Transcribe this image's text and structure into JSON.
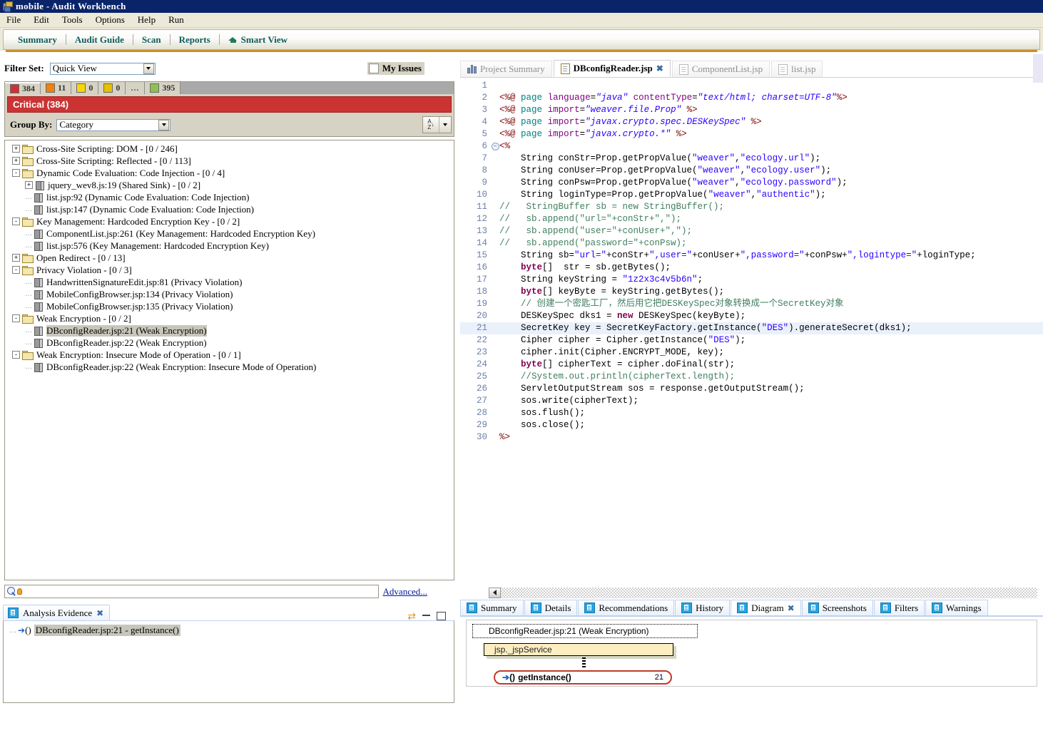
{
  "window": {
    "title": "mobile - Audit Workbench",
    "icon": "app-icon"
  },
  "menu": {
    "items": [
      "File",
      "Edit",
      "Tools",
      "Options",
      "Help",
      "Run"
    ]
  },
  "toolbar": {
    "items": [
      "Summary",
      "Audit Guide",
      "Scan",
      "Reports"
    ],
    "smart_view": "Smart View",
    "smart_view_icon": "graduation-cap-icon"
  },
  "filter": {
    "label": "Filter Set:",
    "value": "Quick View",
    "my_issues_label": "My Issues",
    "my_issues_checked": false,
    "group_by_label": "Group By:",
    "group_by_value": "Category",
    "sort_button_label": "A Z",
    "severity_tabs": [
      {
        "count": "384",
        "color": "#cc3333",
        "active": true
      },
      {
        "count": "11",
        "color": "#f08010",
        "active": false
      },
      {
        "count": "0",
        "color": "#f7d70a",
        "active": false
      },
      {
        "count": "0",
        "color": "#e5c200",
        "active": false
      },
      {
        "count": "...",
        "color": "",
        "active": false
      },
      {
        "count": "395",
        "color": "#8cc152",
        "active": false
      }
    ],
    "critical_banner": "Critical (384)"
  },
  "tree": {
    "nodes": [
      {
        "depth": 0,
        "toggle": "+",
        "icon": "folder-icon",
        "label": "Cross-Site Scripting: DOM - [0 / 246]",
        "selected": false
      },
      {
        "depth": 0,
        "toggle": "+",
        "icon": "folder-icon",
        "label": "Cross-Site Scripting: Reflected - [0 / 113]",
        "selected": false
      },
      {
        "depth": 0,
        "toggle": "-",
        "icon": "folder-icon",
        "label": "Dynamic Code Evaluation: Code Injection - [0 / 4]",
        "selected": false
      },
      {
        "depth": 1,
        "toggle": "+",
        "icon": "document-icon",
        "label": "jquery_wev8.js:19 (Shared Sink) - [0 / 2]",
        "selected": false
      },
      {
        "depth": 1,
        "toggle": "",
        "icon": "document-icon",
        "label": "list.jsp:92 (Dynamic Code Evaluation: Code Injection)",
        "selected": false
      },
      {
        "depth": 1,
        "toggle": "",
        "icon": "document-icon",
        "label": "list.jsp:147 (Dynamic Code Evaluation: Code Injection)",
        "selected": false
      },
      {
        "depth": 0,
        "toggle": "-",
        "icon": "folder-icon",
        "label": "Key Management: Hardcoded Encryption Key - [0 / 2]",
        "selected": false
      },
      {
        "depth": 1,
        "toggle": "",
        "icon": "document-icon",
        "label": "ComponentList.jsp:261 (Key Management: Hardcoded Encryption Key)",
        "selected": false
      },
      {
        "depth": 1,
        "toggle": "",
        "icon": "document-icon",
        "label": "list.jsp:576 (Key Management: Hardcoded Encryption Key)",
        "selected": false
      },
      {
        "depth": 0,
        "toggle": "+",
        "icon": "folder-icon",
        "label": "Open Redirect - [0 / 13]",
        "selected": false
      },
      {
        "depth": 0,
        "toggle": "-",
        "icon": "folder-icon",
        "label": "Privacy Violation - [0 / 3]",
        "selected": false
      },
      {
        "depth": 1,
        "toggle": "",
        "icon": "document-icon",
        "label": "HandwrittenSignatureEdit.jsp:81 (Privacy Violation)",
        "selected": false
      },
      {
        "depth": 1,
        "toggle": "",
        "icon": "document-icon",
        "label": "MobileConfigBrowser.jsp:134 (Privacy Violation)",
        "selected": false
      },
      {
        "depth": 1,
        "toggle": "",
        "icon": "document-icon",
        "label": "MobileConfigBrowser.jsp:135 (Privacy Violation)",
        "selected": false
      },
      {
        "depth": 0,
        "toggle": "-",
        "icon": "folder-icon",
        "label": "Weak Encryption - [0 / 2]",
        "selected": false
      },
      {
        "depth": 1,
        "toggle": "",
        "icon": "document-icon",
        "label": "DBconfigReader.jsp:21 (Weak Encryption)",
        "selected": true
      },
      {
        "depth": 1,
        "toggle": "",
        "icon": "document-icon",
        "label": "DBconfigReader.jsp:22 (Weak Encryption)",
        "selected": false
      },
      {
        "depth": 0,
        "toggle": "-",
        "icon": "folder-icon",
        "label": "Weak Encryption: Insecure Mode of Operation - [0 / 1]",
        "selected": false
      },
      {
        "depth": 1,
        "toggle": "",
        "icon": "document-icon",
        "label": "DBconfigReader.jsp:22 (Weak Encryption: Insecure Mode of Operation)",
        "selected": false
      }
    ]
  },
  "search": {
    "placeholder": "",
    "value": "",
    "advanced_label": "Advanced..."
  },
  "evidence": {
    "tab_label": "Analysis Evidence",
    "rows": [
      {
        "label": "DBconfigReader.jsp:21 - getInstance()",
        "selected": true
      }
    ]
  },
  "editor_tabs": [
    {
      "label": "Project Summary",
      "icon": "chart-icon",
      "active": false,
      "closable": false
    },
    {
      "label": "DBconfigReader.jsp",
      "icon": "page-icon",
      "active": true,
      "closable": true
    },
    {
      "label": "ComponentList.jsp",
      "icon": "page-icon",
      "active": false,
      "closable": false
    },
    {
      "label": "list.jsp",
      "icon": "page-icon",
      "active": false,
      "closable": false
    }
  ],
  "code": {
    "highlight_line": 21,
    "fold_line": 6,
    "lines": [
      {
        "n": 1,
        "html": ""
      },
      {
        "n": 2,
        "html": "<span class=\"jspbrk\">&lt;%@</span> <span class=\"jsp\">page</span> <span class=\"jspattr\">language</span>=<span class=\"str\"><i>\"java\"</i></span> <span class=\"jspattr\">contentType</span>=<span class=\"str\"><i>\"text/html; charset=UTF-8\"</i></span><span class=\"jspbrk\">%&gt;</span>"
      },
      {
        "n": 3,
        "html": "<span class=\"jspbrk\">&lt;%@</span> <span class=\"jsp\">page</span> <span class=\"jspattr\">import</span>=<span class=\"str\"><i>\"weaver.file.Prop\"</i></span> <span class=\"jspbrk\">%&gt;</span>"
      },
      {
        "n": 4,
        "html": "<span class=\"jspbrk\">&lt;%@</span> <span class=\"jsp\">page</span> <span class=\"jspattr\">import</span>=<span class=\"str\"><i>\"javax.crypto.spec.DESKeySpec\"</i></span> <span class=\"jspbrk\">%&gt;</span>"
      },
      {
        "n": 5,
        "html": "<span class=\"jspbrk\">&lt;%@</span> <span class=\"jsp\">page</span> <span class=\"jspattr\">import</span>=<span class=\"str\"><i>\"javax.crypto.*\"</i></span> <span class=\"jspbrk\">%&gt;</span>"
      },
      {
        "n": 6,
        "html": "<span class=\"jspbrk\">&lt;%</span>"
      },
      {
        "n": 7,
        "html": "    String conStr=Prop.getPropValue(<span class=\"str\">\"weaver\"</span>,<span class=\"str\">\"ecology.url\"</span>);"
      },
      {
        "n": 8,
        "html": "    String conUser=Prop.getPropValue(<span class=\"str\">\"weaver\"</span>,<span class=\"str\">\"ecology.user\"</span>);"
      },
      {
        "n": 9,
        "html": "    String conPsw=Prop.getPropValue(<span class=\"str\">\"weaver\"</span>,<span class=\"str\">\"ecology.password\"</span>);"
      },
      {
        "n": 10,
        "html": "    String loginType=Prop.getPropValue(<span class=\"str\">\"weaver\"</span>,<span class=\"str\">\"authentic\"</span>);"
      },
      {
        "n": 11,
        "html": "<span class=\"cmt\">//   StringBuffer sb = new StringBuffer();</span>"
      },
      {
        "n": 12,
        "html": "<span class=\"cmt\">//   sb.append(\"url=\"+conStr+\",\");</span>"
      },
      {
        "n": 13,
        "html": "<span class=\"cmt\">//   sb.append(\"user=\"+conUser+\",\");</span>"
      },
      {
        "n": 14,
        "html": "<span class=\"cmt\">//   sb.append(\"password=\"+conPsw);</span>"
      },
      {
        "n": 15,
        "html": "    String sb=<span class=\"str\">\"url=\"</span>+conStr+<span class=\"str\">\",user=\"</span>+conUser+<span class=\"str\">\",password=\"</span>+conPsw+<span class=\"str\">\",logintype=\"</span>+loginType;"
      },
      {
        "n": 16,
        "html": "    <span class=\"kw\">byte</span>[]  str = sb.getBytes();"
      },
      {
        "n": 17,
        "html": "    String keyString = <span class=\"str\">\"1z2x3c4v5b6n\"</span>;"
      },
      {
        "n": 18,
        "html": "    <span class=\"kw\">byte</span>[] keyByte = keyString.getBytes();"
      },
      {
        "n": 19,
        "html": "    <span class=\"cmt\">// 创建一个密匙工厂，然后用它把DESKeySpec对象转换成一个SecretKey对象</span>"
      },
      {
        "n": 20,
        "html": "    DESKeySpec dks1 = <span class=\"kw\">new</span> DESKeySpec(keyByte);"
      },
      {
        "n": 21,
        "html": "    SecretKey key = SecretKeyFactory.getInstance(<span class=\"str\">\"DES\"</span>).generateSecret(dks1);"
      },
      {
        "n": 22,
        "html": "    Cipher cipher = Cipher.getInstance(<span class=\"str\">\"DES\"</span>);"
      },
      {
        "n": 23,
        "html": "    cipher.init(Cipher.ENCRYPT_MODE, key);"
      },
      {
        "n": 24,
        "html": "    <span class=\"kw\">byte</span>[] cipherText = cipher.doFinal(str);"
      },
      {
        "n": 25,
        "html": "    <span class=\"cmt\">//System.out.println(cipherText.length);</span>"
      },
      {
        "n": 26,
        "html": "    ServletOutputStream sos = response.getOutputStream();"
      },
      {
        "n": 27,
        "html": "    sos.write(cipherText);"
      },
      {
        "n": 28,
        "html": "    sos.flush();"
      },
      {
        "n": 29,
        "html": "    sos.close();"
      },
      {
        "n": 30,
        "html": "<span class=\"jspbrk\">%&gt;</span>"
      }
    ]
  },
  "bottom_tabs": [
    {
      "label": "Summary",
      "active": false,
      "closable": false
    },
    {
      "label": "Details",
      "active": false,
      "closable": false
    },
    {
      "label": "Recommendations",
      "active": false,
      "closable": false
    },
    {
      "label": "History",
      "active": false,
      "closable": false
    },
    {
      "label": "Diagram",
      "active": true,
      "closable": true
    },
    {
      "label": "Screenshots",
      "active": false,
      "closable": false
    },
    {
      "label": "Filters",
      "active": false,
      "closable": false
    },
    {
      "label": "Warnings",
      "active": false,
      "closable": false
    }
  ],
  "diagram": {
    "header": "DBconfigReader.jsp:21 (Weak Encryption)",
    "node_caller": "jsp._jspService",
    "node_sink": "getInstance()",
    "node_sink_line": "21"
  }
}
